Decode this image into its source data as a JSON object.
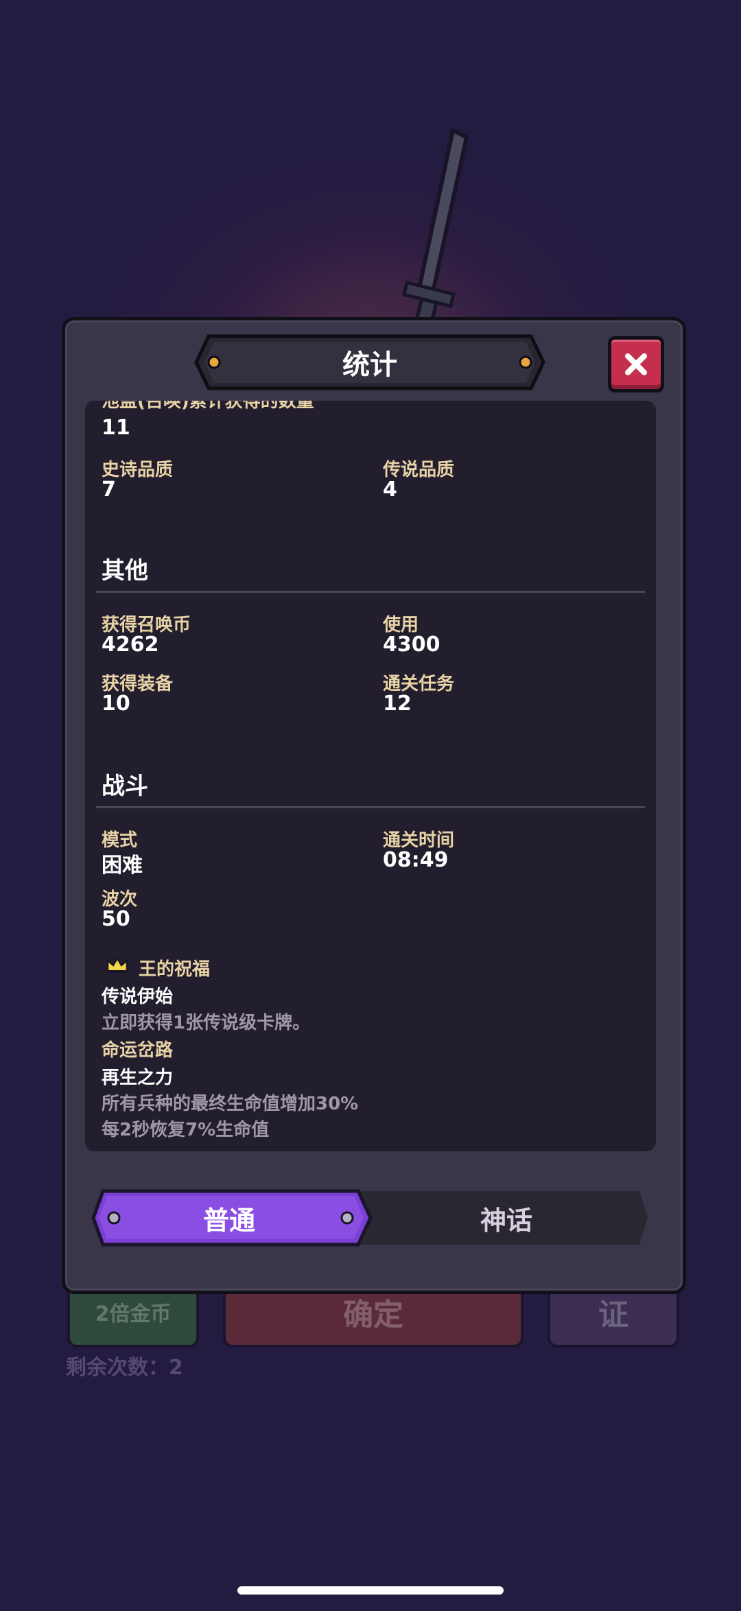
{
  "modal": {
    "title": "统计",
    "cut_off_label": "池盖(召唤)累计获得的数量",
    "rows_top": [
      {
        "label": "",
        "value": "11"
      },
      {
        "label": "史诗品质",
        "value": "7"
      },
      {
        "label": "传说品质",
        "value": "4"
      }
    ],
    "other": {
      "title": "其他",
      "items": [
        {
          "label": "获得召唤币",
          "value": "4262"
        },
        {
          "label": "使用",
          "value": "4300"
        },
        {
          "label": "获得装备",
          "value": "10"
        },
        {
          "label": "通关任务",
          "value": "12"
        }
      ]
    },
    "battle": {
      "title": "战斗",
      "items": [
        {
          "label": "模式",
          "value": "困难"
        },
        {
          "label": "通关时间",
          "value": "08:49"
        },
        {
          "label": "波次",
          "value": "50"
        }
      ],
      "blessing_title": "王的祝福",
      "blessing_name": "传说伊始",
      "blessing_desc": "立即获得1张传说级卡牌。",
      "fate_title": "命运岔路",
      "fate_name": "再生之力",
      "fate_desc_1": "所有兵种的最终生命值增加30%",
      "fate_desc_2": "每2秒恢复7%生命值"
    },
    "tabs": [
      {
        "label": "普通",
        "active": true
      },
      {
        "label": "神话",
        "active": false
      }
    ]
  },
  "background": {
    "double_coins": "2倍金币",
    "confirm": "确定",
    "third": "证",
    "remaining": "剩余次数：2"
  },
  "colors": {
    "accent_purple": "#7b3fd6",
    "close_red": "#c52f4d",
    "label_gold": "#e8d3a6",
    "panel_bg": "#231e2e",
    "modal_bg": "#3a3548"
  },
  "icons": [
    "close-icon",
    "crown-icon",
    "sword-icon"
  ]
}
